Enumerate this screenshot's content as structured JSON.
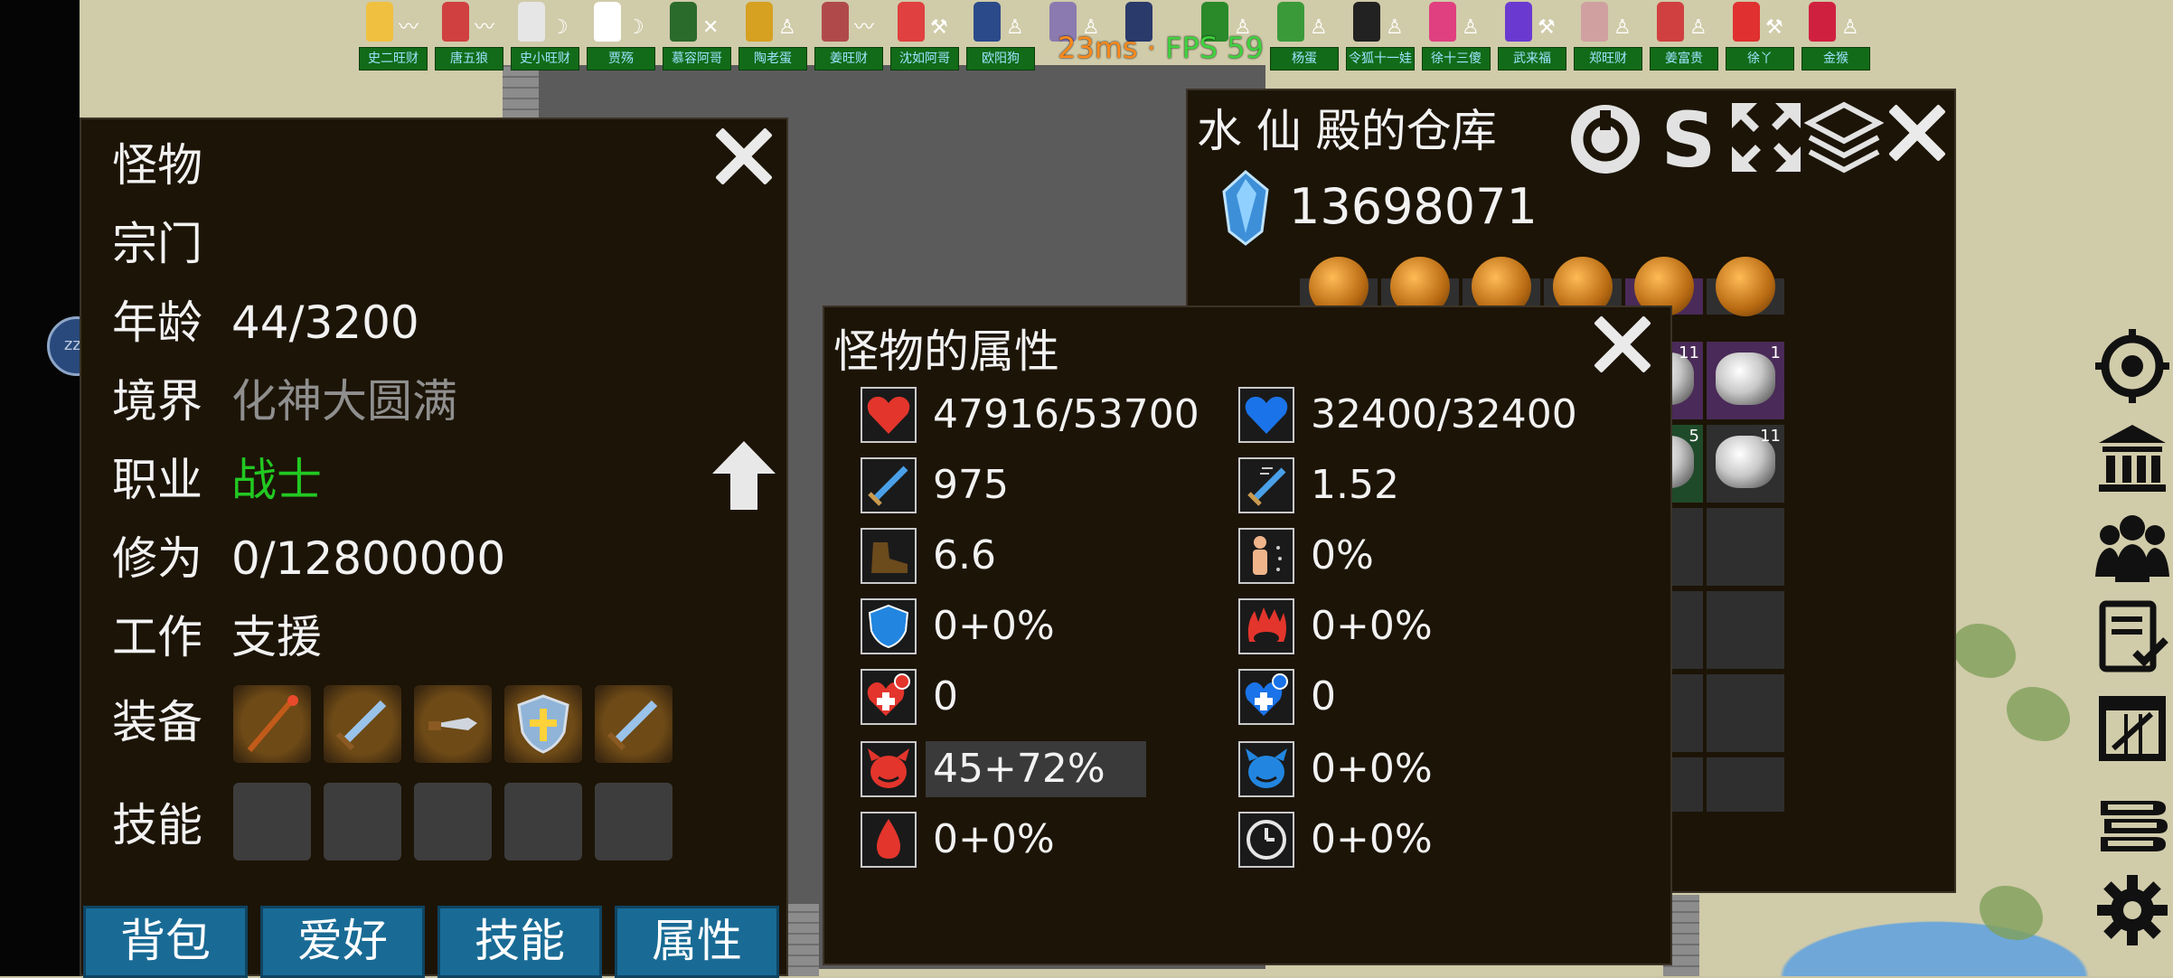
{
  "performance": {
    "ping": "23ms",
    "separator": "·",
    "fps": "FPS 59"
  },
  "characters": [
    {
      "name": "史二旺财",
      "color": "#f0c040",
      "act": "〰"
    },
    {
      "name": "唐五狼",
      "color": "#d04040",
      "act": "〰"
    },
    {
      "name": "史小旺财",
      "color": "#e6e6e6",
      "act": "☽"
    },
    {
      "name": "贾殇",
      "color": "#ffffff",
      "act": "☽"
    },
    {
      "name": "慕容阿哥",
      "color": "#2a6a2a",
      "act": "✕"
    },
    {
      "name": "陶老蛋",
      "color": "#d6a020",
      "act": "♙"
    },
    {
      "name": "姜旺财",
      "color": "#b04a4a",
      "act": "〰"
    },
    {
      "name": "沈如阿哥",
      "color": "#e04040",
      "act": "⚒"
    },
    {
      "name": "欧阳狗",
      "color": "#2a4a8a",
      "act": "♙"
    },
    {
      "name": "",
      "color": "#8a7ab0",
      "act": "♙"
    },
    {
      "name": "",
      "color": "#2a3a6a",
      "act": ""
    },
    {
      "name": "",
      "color": "#2a8a2a",
      "act": "♙"
    },
    {
      "name": "杨蛋",
      "color": "#3a9a3a",
      "act": "♙"
    },
    {
      "name": "令狐十一娃",
      "color": "#222222",
      "act": "♙"
    },
    {
      "name": "徐十三傻",
      "color": "#e04080",
      "act": "♙"
    },
    {
      "name": "武来福",
      "color": "#6a3ad0",
      "act": "⚒"
    },
    {
      "name": "郑旺财",
      "color": "#d0a0a0",
      "act": "♙"
    },
    {
      "name": "姜富贵",
      "color": "#d04040",
      "act": "♙"
    },
    {
      "name": "徐丫",
      "color": "#e03030",
      "act": "⚒"
    },
    {
      "name": "金猴",
      "color": "#d02040",
      "act": "♙"
    }
  ],
  "monster_panel": {
    "rows": [
      {
        "label": "怪物",
        "value": ""
      },
      {
        "label": "宗门",
        "value": ""
      },
      {
        "label": "年龄",
        "value": "44/3200"
      },
      {
        "label": "境界",
        "value": "化神大圆满"
      },
      {
        "label": "职业",
        "value": "战士"
      },
      {
        "label": "修为",
        "value": "0/12800000"
      },
      {
        "label": "工作",
        "value": "支援"
      }
    ],
    "equip_label": "装备",
    "skill_label": "技能",
    "equipment_icons": [
      "staff-icon",
      "sword-icon",
      "dagger-icon",
      "shield-icon",
      "sword-icon"
    ],
    "tabs": [
      "背包",
      "爱好",
      "技能",
      "属性"
    ]
  },
  "warehouse": {
    "title": "水 仙 殿的仓库",
    "currency": "13698071",
    "tools": [
      "refresh-icon",
      "sort-icon",
      "expand-icon",
      "layers-icon"
    ],
    "counts": [
      "11",
      "1",
      "5",
      "11"
    ]
  },
  "attributes": {
    "title": "怪物的属性",
    "items": [
      {
        "icon": "heart-red-icon",
        "value": "47916/53700"
      },
      {
        "icon": "heart-blue-icon",
        "value": "32400/32400"
      },
      {
        "icon": "sword-attack-icon",
        "value": "975"
      },
      {
        "icon": "sword-speed-icon",
        "value": "1.52"
      },
      {
        "icon": "boot-icon",
        "value": "6.6"
      },
      {
        "icon": "body-dodge-icon",
        "value": "0%"
      },
      {
        "icon": "shield-blue-icon",
        "value": "0+0%"
      },
      {
        "icon": "fire-icon",
        "value": "0+0%"
      },
      {
        "icon": "hp-regen-icon",
        "value": "0"
      },
      {
        "icon": "mp-regen-icon",
        "value": "0"
      },
      {
        "icon": "red-demon-icon",
        "value": "45+72%"
      },
      {
        "icon": "blue-demon-icon",
        "value": "0+0%"
      },
      {
        "icon": "blood-drop-icon",
        "value": "0+0%"
      },
      {
        "icon": "clock-icon",
        "value": "0+0%"
      }
    ]
  },
  "sleep_bubble": "zzz",
  "sidebar": [
    "target-icon",
    "temple-icon",
    "group-icon",
    "tasks-icon",
    "calendar-icon",
    "books-icon",
    "gear-icon"
  ]
}
